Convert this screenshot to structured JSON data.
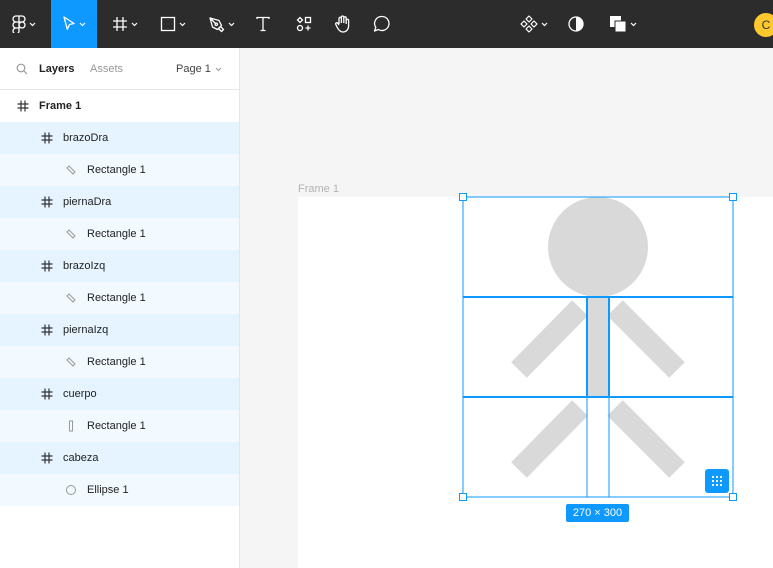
{
  "toolbar": {
    "tools": [
      {
        "name": "main-menu",
        "icon": "figma-logo-icon"
      },
      {
        "name": "move-tool",
        "icon": "cursor-arrow-icon",
        "active": true
      },
      {
        "name": "frame-tool",
        "icon": "hash-frame-icon"
      },
      {
        "name": "shape-tool",
        "icon": "rectangle-icon"
      },
      {
        "name": "pen-tool",
        "icon": "pen-icon"
      },
      {
        "name": "text-tool",
        "icon": "text-icon"
      },
      {
        "name": "resources-tool",
        "icon": "resources-icon"
      },
      {
        "name": "hand-tool",
        "icon": "hand-icon"
      },
      {
        "name": "comment-tool",
        "icon": "comment-icon"
      },
      {
        "name": "component-menu",
        "icon": "component-icon"
      },
      {
        "name": "mask-tool",
        "icon": "contrast-icon"
      },
      {
        "name": "boolean-menu",
        "icon": "boolean-icon"
      }
    ],
    "avatar_initial": "C",
    "accent_color": "#0d99ff",
    "avatar_color": "#ffc82c"
  },
  "layers_panel": {
    "tabs": [
      {
        "label": "Layers",
        "active": true
      },
      {
        "label": "Assets",
        "active": false
      }
    ],
    "page": "Page 1",
    "layers": [
      {
        "label": "Frame 1",
        "icon": "hash-frame-icon",
        "level": 0,
        "state": "none"
      },
      {
        "label": "brazoDra",
        "icon": "hash-frame-icon",
        "level": 1,
        "state": "sel-parent"
      },
      {
        "label": "Rectangle 1",
        "icon": "rotated-rectangle-icon",
        "level": 2,
        "state": "sel-child"
      },
      {
        "label": "piernaDra",
        "icon": "hash-frame-icon",
        "level": 1,
        "state": "sel-parent"
      },
      {
        "label": "Rectangle 1",
        "icon": "rotated-rectangle-icon",
        "level": 2,
        "state": "sel-child"
      },
      {
        "label": "brazoIzq",
        "icon": "hash-frame-icon",
        "level": 1,
        "state": "sel-parent"
      },
      {
        "label": "Rectangle 1",
        "icon": "rotated-rectangle-icon",
        "level": 2,
        "state": "sel-child"
      },
      {
        "label": "piernaIzq",
        "icon": "hash-frame-icon",
        "level": 1,
        "state": "sel-parent"
      },
      {
        "label": "Rectangle 1",
        "icon": "rotated-rectangle-icon",
        "level": 2,
        "state": "sel-child"
      },
      {
        "label": "cuerpo",
        "icon": "hash-frame-icon",
        "level": 1,
        "state": "sel-parent"
      },
      {
        "label": "Rectangle 1",
        "icon": "vertical-rectangle-icon",
        "level": 2,
        "state": "sel-child"
      },
      {
        "label": "cabeza",
        "icon": "hash-frame-icon",
        "level": 1,
        "state": "sel-parent"
      },
      {
        "label": "Ellipse 1",
        "icon": "ellipse-icon",
        "level": 2,
        "state": "sel-child"
      }
    ]
  },
  "canvas": {
    "frame_label": "Frame 1",
    "selection_size": "270 × 300",
    "shape_fill": "#d9d9d9",
    "selection_color": "#0d99ff"
  }
}
